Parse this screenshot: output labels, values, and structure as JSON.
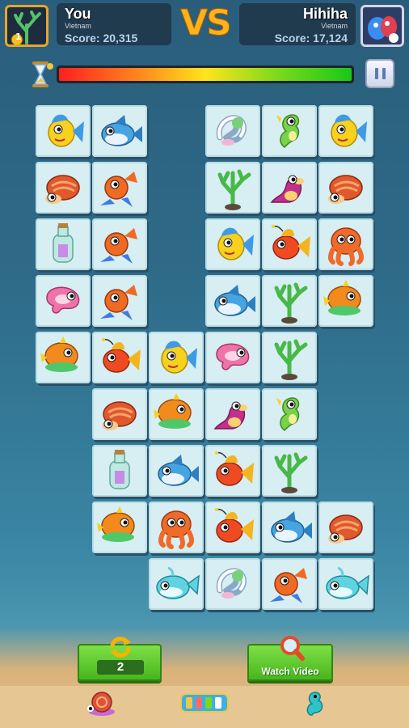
{
  "player": {
    "name": "You",
    "country": "Vietnam",
    "score": "Score: 20,315",
    "badge": "1"
  },
  "opponent": {
    "name": "Hihiha",
    "country": "Vietnam",
    "score": "Score: 17,124"
  },
  "vs_label": "VS",
  "timer": {
    "remaining_fraction": 1.0
  },
  "board": {
    "rows": [
      [
        "yellow-fish",
        "blue-fish",
        null,
        "white-seahorse",
        "green-seahorse",
        "yellow-fish"
      ],
      [
        "hermit-crab",
        "red-fish",
        null,
        "green-coral",
        "pink-seal",
        "hermit-crab"
      ],
      [
        "bottle",
        "red-fish",
        null,
        "yellow-fish",
        "goldfish",
        "octopus"
      ],
      [
        "pink-squid",
        "red-fish",
        null,
        "blue-fish",
        "green-coral",
        "orange-fish"
      ],
      [
        "orange-fish",
        "goldfish",
        "yellow-fish",
        "pink-squid",
        "green-coral",
        null
      ],
      [
        null,
        "hermit-crab",
        "orange-fish",
        "pink-seal",
        "green-seahorse",
        null
      ],
      [
        null,
        "bottle",
        "blue-fish",
        "goldfish",
        "green-coral",
        null
      ],
      [
        null,
        "orange-fish",
        "octopus",
        "goldfish",
        "blue-fish",
        "hermit-crab"
      ],
      [
        null,
        null,
        "whale",
        "white-seahorse",
        "red-fish",
        "whale"
      ]
    ]
  },
  "controls": {
    "shuffle_count": "2",
    "watch_video_label": "Watch Video"
  },
  "colors": {
    "vs": "#ffb219",
    "tile": "#d7eef2",
    "button": "#48b61e"
  }
}
